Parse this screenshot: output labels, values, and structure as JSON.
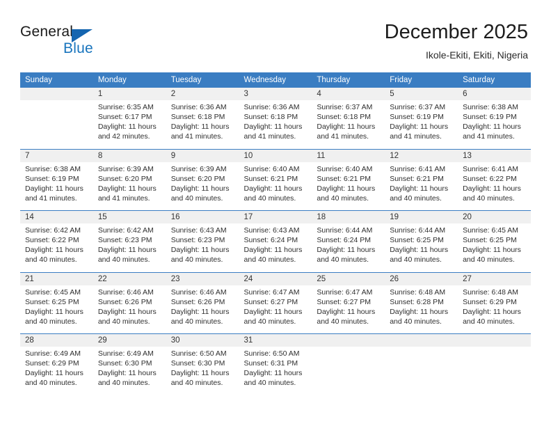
{
  "brand": {
    "name_part1": "General",
    "name_part2": "Blue",
    "logo_icon": "blue-triangle-icon",
    "accent_color": "#1874bd"
  },
  "header": {
    "title": "December 2025",
    "subtitle": "Ikole-Ekiti, Ekiti, Nigeria"
  },
  "colors": {
    "header_bar": "#3a7dc2",
    "daynum_band": "#f0f0f0",
    "cell_background": "#ffffff",
    "text": "#2e2e2e"
  },
  "weekdays": [
    "Sunday",
    "Monday",
    "Tuesday",
    "Wednesday",
    "Thursday",
    "Friday",
    "Saturday"
  ],
  "weeks": [
    {
      "days": [
        {
          "num": "",
          "sunrise": "",
          "sunset": "",
          "daylight_1": "",
          "daylight_2": ""
        },
        {
          "num": "1",
          "sunrise": "Sunrise: 6:35 AM",
          "sunset": "Sunset: 6:17 PM",
          "daylight_1": "Daylight: 11 hours",
          "daylight_2": "and 42 minutes."
        },
        {
          "num": "2",
          "sunrise": "Sunrise: 6:36 AM",
          "sunset": "Sunset: 6:18 PM",
          "daylight_1": "Daylight: 11 hours",
          "daylight_2": "and 41 minutes."
        },
        {
          "num": "3",
          "sunrise": "Sunrise: 6:36 AM",
          "sunset": "Sunset: 6:18 PM",
          "daylight_1": "Daylight: 11 hours",
          "daylight_2": "and 41 minutes."
        },
        {
          "num": "4",
          "sunrise": "Sunrise: 6:37 AM",
          "sunset": "Sunset: 6:18 PM",
          "daylight_1": "Daylight: 11 hours",
          "daylight_2": "and 41 minutes."
        },
        {
          "num": "5",
          "sunrise": "Sunrise: 6:37 AM",
          "sunset": "Sunset: 6:19 PM",
          "daylight_1": "Daylight: 11 hours",
          "daylight_2": "and 41 minutes."
        },
        {
          "num": "6",
          "sunrise": "Sunrise: 6:38 AM",
          "sunset": "Sunset: 6:19 PM",
          "daylight_1": "Daylight: 11 hours",
          "daylight_2": "and 41 minutes."
        }
      ]
    },
    {
      "days": [
        {
          "num": "7",
          "sunrise": "Sunrise: 6:38 AM",
          "sunset": "Sunset: 6:19 PM",
          "daylight_1": "Daylight: 11 hours",
          "daylight_2": "and 41 minutes."
        },
        {
          "num": "8",
          "sunrise": "Sunrise: 6:39 AM",
          "sunset": "Sunset: 6:20 PM",
          "daylight_1": "Daylight: 11 hours",
          "daylight_2": "and 41 minutes."
        },
        {
          "num": "9",
          "sunrise": "Sunrise: 6:39 AM",
          "sunset": "Sunset: 6:20 PM",
          "daylight_1": "Daylight: 11 hours",
          "daylight_2": "and 40 minutes."
        },
        {
          "num": "10",
          "sunrise": "Sunrise: 6:40 AM",
          "sunset": "Sunset: 6:21 PM",
          "daylight_1": "Daylight: 11 hours",
          "daylight_2": "and 40 minutes."
        },
        {
          "num": "11",
          "sunrise": "Sunrise: 6:40 AM",
          "sunset": "Sunset: 6:21 PM",
          "daylight_1": "Daylight: 11 hours",
          "daylight_2": "and 40 minutes."
        },
        {
          "num": "12",
          "sunrise": "Sunrise: 6:41 AM",
          "sunset": "Sunset: 6:21 PM",
          "daylight_1": "Daylight: 11 hours",
          "daylight_2": "and 40 minutes."
        },
        {
          "num": "13",
          "sunrise": "Sunrise: 6:41 AM",
          "sunset": "Sunset: 6:22 PM",
          "daylight_1": "Daylight: 11 hours",
          "daylight_2": "and 40 minutes."
        }
      ]
    },
    {
      "days": [
        {
          "num": "14",
          "sunrise": "Sunrise: 6:42 AM",
          "sunset": "Sunset: 6:22 PM",
          "daylight_1": "Daylight: 11 hours",
          "daylight_2": "and 40 minutes."
        },
        {
          "num": "15",
          "sunrise": "Sunrise: 6:42 AM",
          "sunset": "Sunset: 6:23 PM",
          "daylight_1": "Daylight: 11 hours",
          "daylight_2": "and 40 minutes."
        },
        {
          "num": "16",
          "sunrise": "Sunrise: 6:43 AM",
          "sunset": "Sunset: 6:23 PM",
          "daylight_1": "Daylight: 11 hours",
          "daylight_2": "and 40 minutes."
        },
        {
          "num": "17",
          "sunrise": "Sunrise: 6:43 AM",
          "sunset": "Sunset: 6:24 PM",
          "daylight_1": "Daylight: 11 hours",
          "daylight_2": "and 40 minutes."
        },
        {
          "num": "18",
          "sunrise": "Sunrise: 6:44 AM",
          "sunset": "Sunset: 6:24 PM",
          "daylight_1": "Daylight: 11 hours",
          "daylight_2": "and 40 minutes."
        },
        {
          "num": "19",
          "sunrise": "Sunrise: 6:44 AM",
          "sunset": "Sunset: 6:25 PM",
          "daylight_1": "Daylight: 11 hours",
          "daylight_2": "and 40 minutes."
        },
        {
          "num": "20",
          "sunrise": "Sunrise: 6:45 AM",
          "sunset": "Sunset: 6:25 PM",
          "daylight_1": "Daylight: 11 hours",
          "daylight_2": "and 40 minutes."
        }
      ]
    },
    {
      "days": [
        {
          "num": "21",
          "sunrise": "Sunrise: 6:45 AM",
          "sunset": "Sunset: 6:25 PM",
          "daylight_1": "Daylight: 11 hours",
          "daylight_2": "and 40 minutes."
        },
        {
          "num": "22",
          "sunrise": "Sunrise: 6:46 AM",
          "sunset": "Sunset: 6:26 PM",
          "daylight_1": "Daylight: 11 hours",
          "daylight_2": "and 40 minutes."
        },
        {
          "num": "23",
          "sunrise": "Sunrise: 6:46 AM",
          "sunset": "Sunset: 6:26 PM",
          "daylight_1": "Daylight: 11 hours",
          "daylight_2": "and 40 minutes."
        },
        {
          "num": "24",
          "sunrise": "Sunrise: 6:47 AM",
          "sunset": "Sunset: 6:27 PM",
          "daylight_1": "Daylight: 11 hours",
          "daylight_2": "and 40 minutes."
        },
        {
          "num": "25",
          "sunrise": "Sunrise: 6:47 AM",
          "sunset": "Sunset: 6:27 PM",
          "daylight_1": "Daylight: 11 hours",
          "daylight_2": "and 40 minutes."
        },
        {
          "num": "26",
          "sunrise": "Sunrise: 6:48 AM",
          "sunset": "Sunset: 6:28 PM",
          "daylight_1": "Daylight: 11 hours",
          "daylight_2": "and 40 minutes."
        },
        {
          "num": "27",
          "sunrise": "Sunrise: 6:48 AM",
          "sunset": "Sunset: 6:29 PM",
          "daylight_1": "Daylight: 11 hours",
          "daylight_2": "and 40 minutes."
        }
      ]
    },
    {
      "days": [
        {
          "num": "28",
          "sunrise": "Sunrise: 6:49 AM",
          "sunset": "Sunset: 6:29 PM",
          "daylight_1": "Daylight: 11 hours",
          "daylight_2": "and 40 minutes."
        },
        {
          "num": "29",
          "sunrise": "Sunrise: 6:49 AM",
          "sunset": "Sunset: 6:30 PM",
          "daylight_1": "Daylight: 11 hours",
          "daylight_2": "and 40 minutes."
        },
        {
          "num": "30",
          "sunrise": "Sunrise: 6:50 AM",
          "sunset": "Sunset: 6:30 PM",
          "daylight_1": "Daylight: 11 hours",
          "daylight_2": "and 40 minutes."
        },
        {
          "num": "31",
          "sunrise": "Sunrise: 6:50 AM",
          "sunset": "Sunset: 6:31 PM",
          "daylight_1": "Daylight: 11 hours",
          "daylight_2": "and 40 minutes."
        },
        {
          "num": "",
          "sunrise": "",
          "sunset": "",
          "daylight_1": "",
          "daylight_2": ""
        },
        {
          "num": "",
          "sunrise": "",
          "sunset": "",
          "daylight_1": "",
          "daylight_2": ""
        },
        {
          "num": "",
          "sunrise": "",
          "sunset": "",
          "daylight_1": "",
          "daylight_2": ""
        }
      ]
    }
  ]
}
